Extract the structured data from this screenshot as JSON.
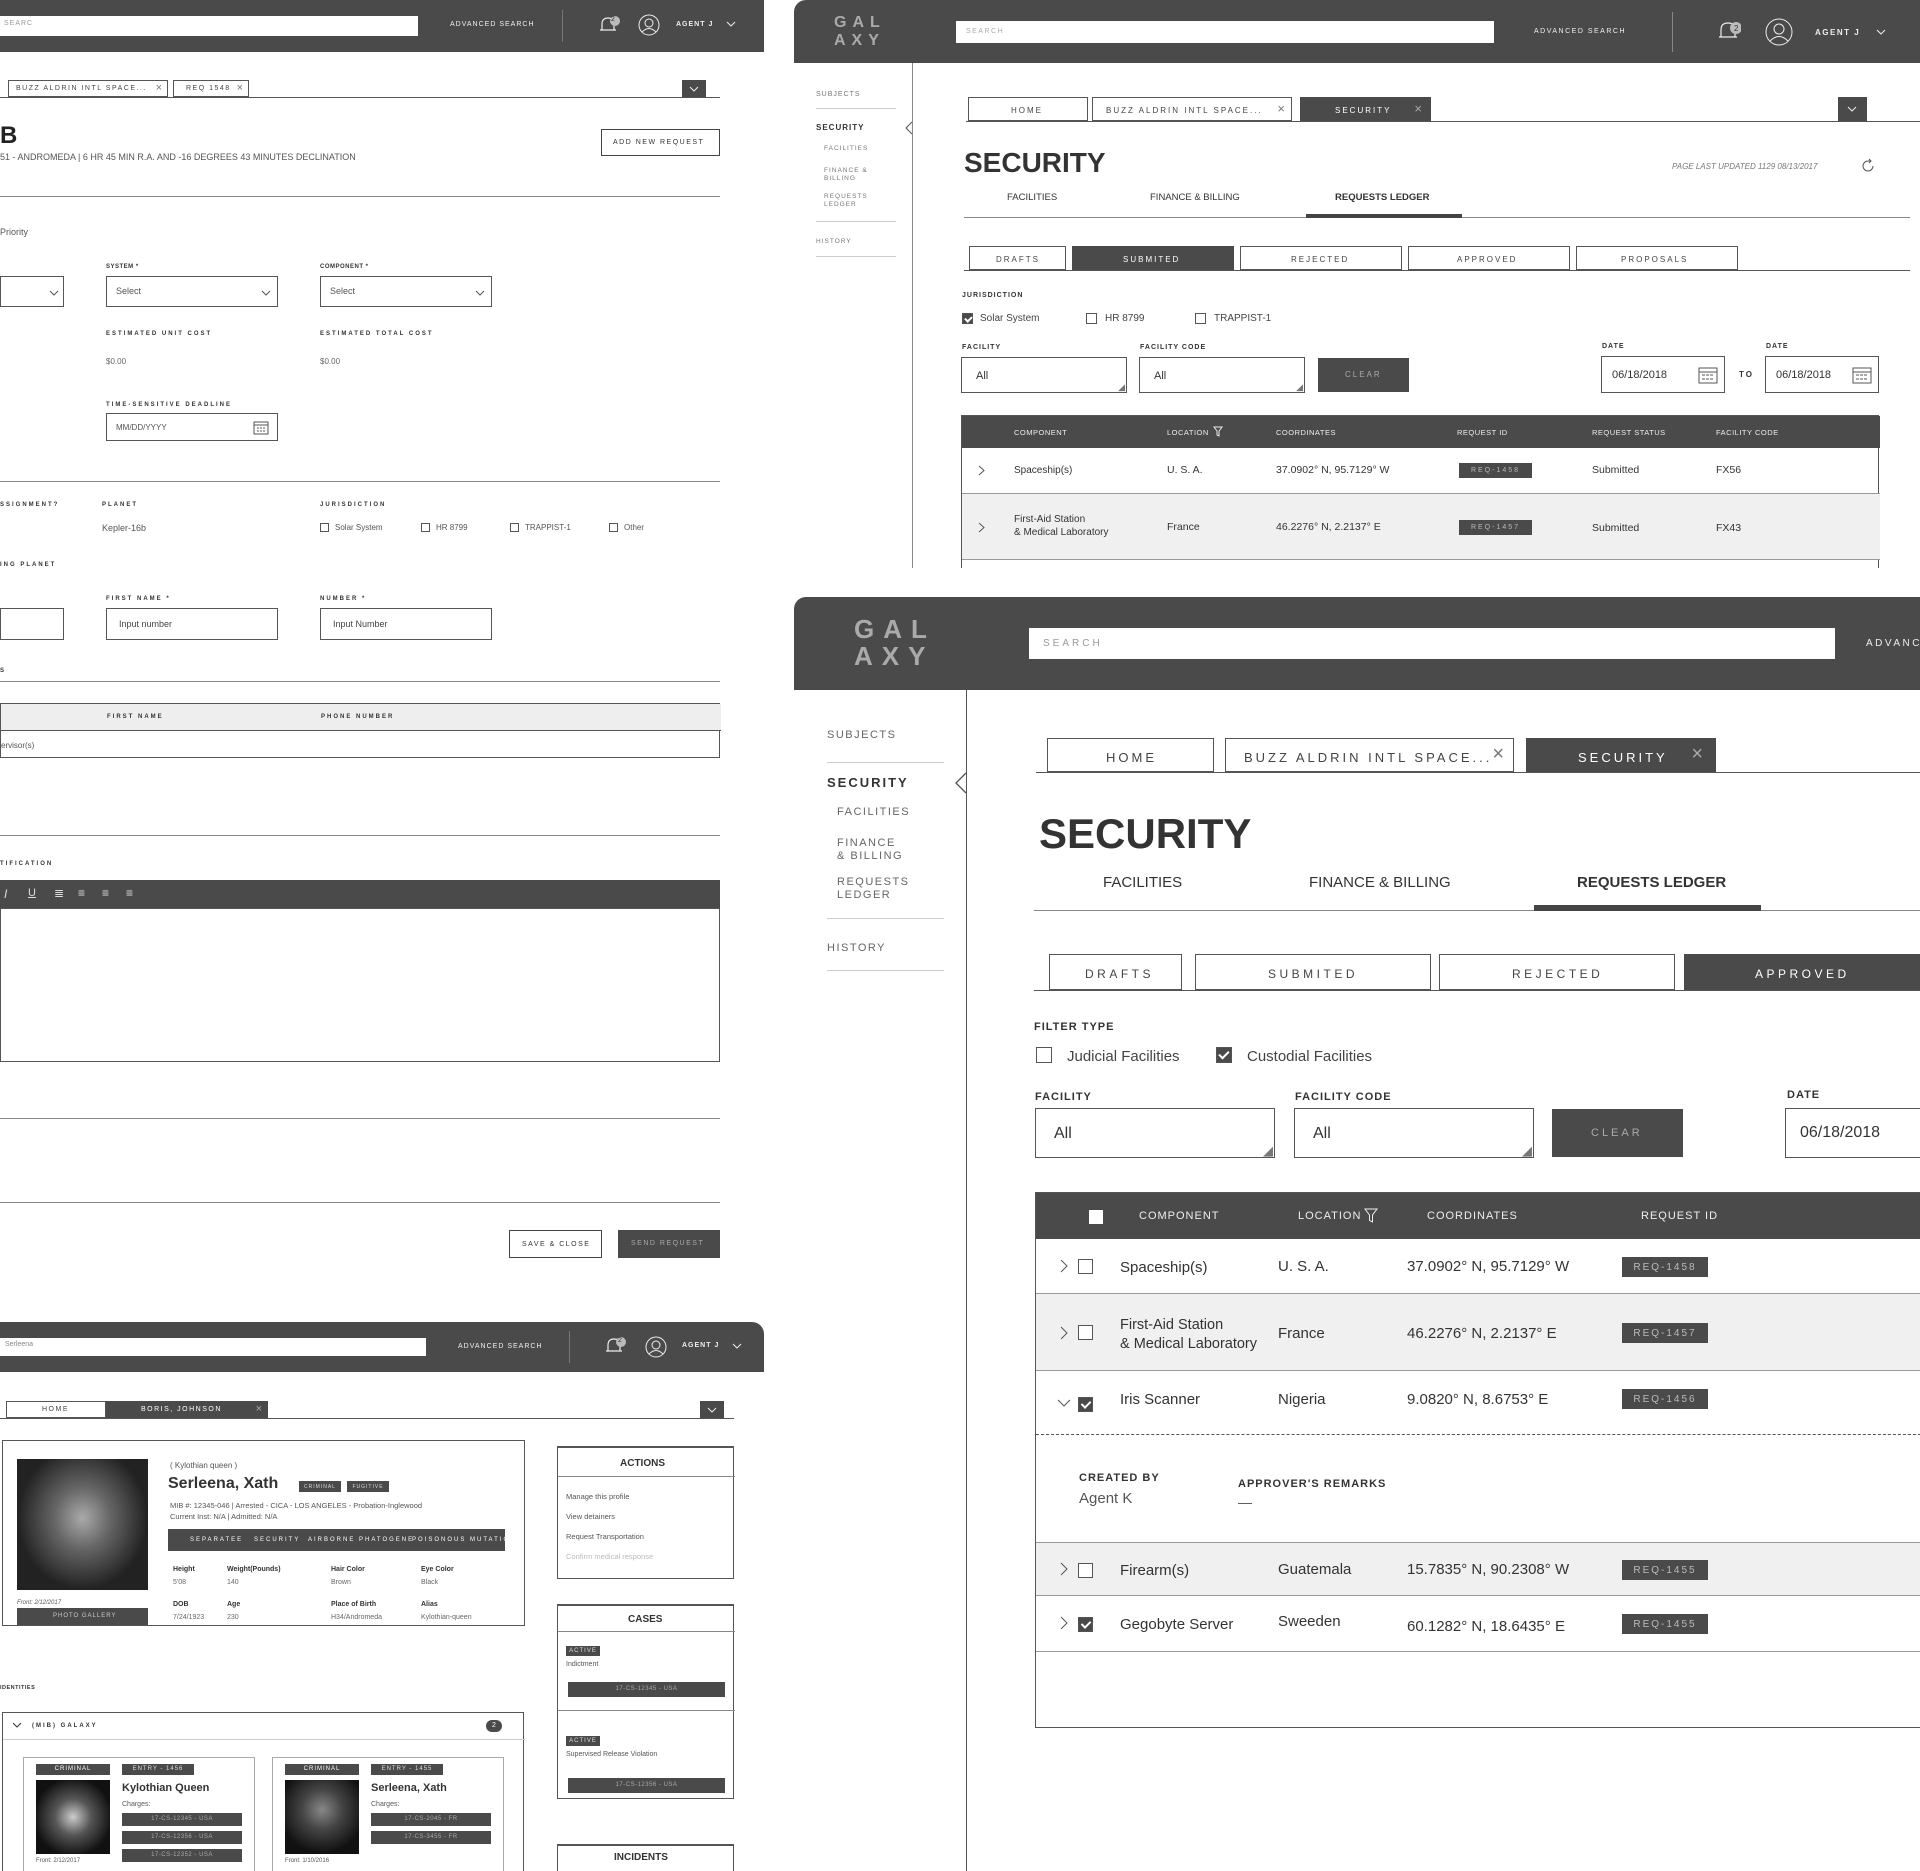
{
  "left_top": {
    "search_value": "SEARC",
    "advanced_search": "ADVANCED SEARCH",
    "notif_count": "2",
    "agent": "AGENT J",
    "tabs": [
      "BUZZ ALDRIN INTL SPACE...",
      "REQ 1548"
    ],
    "page_title": "B",
    "subtitle": "51 - ANDROMEDA | 6 HR 45 MIN R.A. AND -16 DEGREES 43 MINUTES DECLINATION",
    "add_new_request": "ADD NEW REQUEST",
    "priority": "Priority",
    "system_label": "SYSTEM",
    "component_label": "COMPONENT",
    "select": "Select",
    "est_unit_cost_label": "ESTIMATED UNIT COST",
    "est_total_cost_label": "ESTIMATED TOTAL COST",
    "unit_cost": "$0.00",
    "total_cost": "$0.00",
    "deadline_label": "TIME-SENSITIVE DEADLINE",
    "deadline_placeholder": "MM/DD/YYYY",
    "assignment_label": "SSIGNMENT?",
    "planet_label": "PLANET",
    "planet_value": "Kepler-16b",
    "jurisdiction_label": "JURISDICTION",
    "jurisdiction_opts": [
      "Solar System",
      "HR 8799",
      "TRAPPIST-1",
      "Other"
    ],
    "home_planet_label": "ING PLANET",
    "first_name_label": "FIRST NAME",
    "number_label": "NUMBER",
    "input_number": "Input number",
    "input_number2": "Input Number",
    "s_label": "S",
    "table_headers": [
      "FIRST NAME",
      "PHONE NUMBER"
    ],
    "table_row": "ervisor(s)",
    "justification_label": "TIFICATION",
    "save_close": "SAVE & CLOSE",
    "send_request": "SEND REQUEST"
  },
  "profile": {
    "search_value": "Serleena",
    "advanced_search": "ADVANCED SEARCH",
    "notif_count": "2",
    "agent": "AGENT J",
    "tabs": [
      "HOME",
      "BORIS, JOHNSON"
    ],
    "alias_line": "( Kylothian queen )",
    "name": "Serleena, Xath",
    "badges": [
      "CRIMINAL",
      "FUGITIVE"
    ],
    "mib_line": "MIB #: 12345-046  |  Arrested - CICA - LOS ANGELES - Probation-Inglewood",
    "inst_line": "Current Inst: N/A  |  Admitted: N/A",
    "tags": [
      "SEPARATEE",
      "SECURITY",
      "AIRBORNE PHATOGENE",
      "POISONOUS MUTATION"
    ],
    "photo_date": "Front: 2/12/2017",
    "photo_gallery": "PHOTO GALLERY",
    "attrs": [
      {
        "label": "Height",
        "value": "5'08"
      },
      {
        "label": "Weight(Pounds)",
        "value": "140"
      },
      {
        "label": "Hair Color",
        "value": "Brown"
      },
      {
        "label": "Eye Color",
        "value": "Black"
      },
      {
        "label": "DOB",
        "value": "7/24/1923"
      },
      {
        "label": "Age",
        "value": "230"
      },
      {
        "label": "Place of Birth",
        "value": "H34/Andromeda"
      },
      {
        "label": "Alias",
        "value": "Kylothian-queen"
      }
    ],
    "actions_title": "ACTIONS",
    "actions": [
      "Manage this profile",
      "View detainers",
      "Request Transportation",
      "Confirm medical response"
    ],
    "cases_title": "CASES",
    "cases": [
      {
        "status": "ACTIVE",
        "name": "Indictment",
        "code": "17-CS-12345 - USA"
      },
      {
        "status": "ACTIVE",
        "name": "Supervised Release Violation",
        "code": "17-CS-12356 - USA"
      }
    ],
    "incidents_title": "INCIDENTS",
    "identities_label": "IDENTITIES",
    "identities_group": "(MIB) GALAXY",
    "identities_count": "2",
    "cards": [
      {
        "badge": "CRIMINAL",
        "entry": "ENTRY - 1456",
        "name": "Kylothian Queen",
        "charges_label": "Charges:",
        "charges": [
          "17-CS-12345 - USA",
          "17-CS-12356 - USA",
          "17-CS-12352 - USA"
        ],
        "date": "Front: 2/12/2017"
      },
      {
        "badge": "CRIMINAL",
        "entry": "ENTRY - 1455",
        "name": "Serleena, Xath",
        "charges_label": "Charges:",
        "charges": [
          "17-CS-2045 - FR",
          "17-CS-3455 - FR"
        ],
        "date": "Front: 1/10/2016"
      }
    ]
  },
  "sec_small": {
    "logo": [
      "GAL",
      "AXY"
    ],
    "search_placeholder": "SEARCH",
    "advanced_search": "ADVANCED SEARCH",
    "notif_count": "2",
    "agent": "AGENT J",
    "sidebar": [
      "SUBJECTS",
      "SECURITY",
      "FACILITIES",
      "FINANCE & BILLING",
      "REQUESTS LEDGER",
      "HISTORY"
    ],
    "tabs": [
      "HOME",
      "BUZZ ALDRIN INTL SPACE...",
      "SECURITY"
    ],
    "title": "SECURITY",
    "last_updated": "PAGE LAST UPDATED 1129 08/13/2017",
    "subtabs": [
      "FACILITIES",
      "FINANCE & BILLING",
      "REQUESTS LEDGER"
    ],
    "status_tabs": [
      "DRAFTS",
      "SUBMITED",
      "REJECTED",
      "APPROVED",
      "PROPOSALS"
    ],
    "jurisdiction_label": "JURISDICTION",
    "jurisdiction_opts": [
      "Solar System",
      "HR 8799",
      "TRAPPIST-1"
    ],
    "facility_label": "FACILITY",
    "facility_code_label": "FACILITY CODE",
    "all": "All",
    "clear": "CLEAR",
    "date_label": "DATE",
    "date_from": "06/18/2018",
    "to": "TO",
    "date_to": "06/18/2018",
    "headers": [
      "COMPONENT",
      "LOCATION",
      "COORDINATES",
      "REQUEST ID",
      "REQUEST STATUS",
      "FACILITY CODE"
    ],
    "rows": [
      {
        "component": "Spaceship(s)",
        "location": "U. S. A.",
        "coords": "37.0902° N, 95.7129° W",
        "id": "REQ-1458",
        "status": "Submitted",
        "code": "FX56"
      },
      {
        "component": "First-Aid Station",
        "component2": "& Medical Laboratory",
        "location": "France",
        "coords": "46.2276° N, 2.2137° E",
        "id": "REQ-1457",
        "status": "Submitted",
        "code": "FX43"
      }
    ]
  },
  "sec_large": {
    "logo": [
      "GAL",
      "AXY"
    ],
    "search_placeholder": "SEARCH",
    "advanced": "ADVANC",
    "sidebar": [
      "SUBJECTS",
      "SECURITY",
      "FACILITIES",
      "FINANCE & BILLING",
      "REQUESTS LEDGER",
      "HISTORY"
    ],
    "tabs": [
      "HOME",
      "BUZZ ALDRIN INTL SPACE...",
      "SECURITY"
    ],
    "title": "SECURITY",
    "subtabs": [
      "FACILITIES",
      "FINANCE & BILLING",
      "REQUESTS LEDGER"
    ],
    "status_tabs": [
      "DRAFTS",
      "SUBMITED",
      "REJECTED",
      "APPROVED"
    ],
    "filter_type_label": "FILTER TYPE",
    "filter_opts": [
      "Judicial Facilities",
      "Custodial Facilities"
    ],
    "facility_label": "FACILITY",
    "facility_code_label": "FACILITY CODE",
    "all": "All",
    "clear": "CLEAR",
    "date_label": "DATE",
    "date_value": "06/18/2018",
    "headers": [
      "COMPONENT",
      "LOCATION",
      "COORDINATES",
      "REQUEST ID"
    ],
    "rows": [
      {
        "component": "Spaceship(s)",
        "location": "U. S. A.",
        "coords": "37.0902° N, 95.7129° W",
        "id": "REQ-1458"
      },
      {
        "component": "First-Aid Station",
        "component2": "& Medical Laboratory",
        "location": "France",
        "coords": "46.2276° N, 2.2137° E",
        "id": "REQ-1457"
      },
      {
        "component": "Iris Scanner",
        "location": "Nigeria",
        "coords": "9.0820° N, 8.6753° E",
        "id": "REQ-1456"
      },
      {
        "component": "Firearm(s)",
        "location": "Guatemala",
        "coords": "15.7835° N, 90.2308° W",
        "id": "REQ-1455"
      },
      {
        "component": "Gegobyte Server",
        "location": "Sweeden",
        "coords": "60.1282° N, 18.6435° E",
        "id": "REQ-1455"
      }
    ],
    "created_by_label": "CREATED BY",
    "created_by": "Agent K",
    "remarks_label": "APPROVER'S REMARKS",
    "remarks": "—"
  }
}
